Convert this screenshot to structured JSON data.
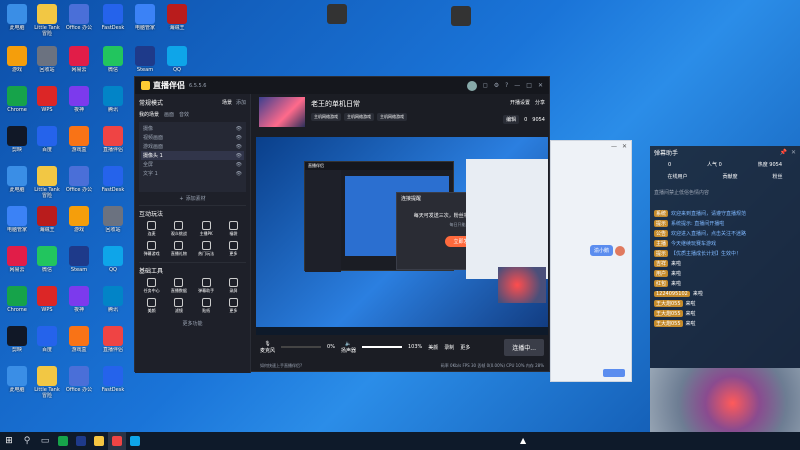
{
  "desktop_icons": [
    {
      "label": "此电脑",
      "color": "#3a8ee6"
    },
    {
      "label": "Little Tank 冒险",
      "color": "#f2c744"
    },
    {
      "label": "Office 办公",
      "color": "#4a6fd8"
    },
    {
      "label": "FastDesk",
      "color": "#2563eb"
    },
    {
      "label": "电脑管家",
      "color": "#3b82f6"
    },
    {
      "label": "海贼王",
      "color": "#b91c1c"
    },
    {
      "label": "游戏",
      "color": "#f59e0b"
    },
    {
      "label": "回收站",
      "color": "#6b7280"
    },
    {
      "label": "网易云",
      "color": "#e11d48"
    },
    {
      "label": "微信",
      "color": "#22c55e"
    },
    {
      "label": "Steam",
      "color": "#1e3a8a"
    },
    {
      "label": "QQ",
      "color": "#0ea5e9"
    },
    {
      "label": "Chrome",
      "color": "#16a34a"
    },
    {
      "label": "WPS",
      "color": "#dc2626"
    },
    {
      "label": "夜神",
      "color": "#7c3aed"
    },
    {
      "label": "腾讯",
      "color": "#0284c7"
    },
    {
      "label": "剪映",
      "color": "#111827"
    },
    {
      "label": "百度",
      "color": "#2563eb"
    },
    {
      "label": "游戏盒",
      "color": "#f97316"
    },
    {
      "label": "直播伴侣",
      "color": "#ef4444"
    }
  ],
  "app": {
    "title": "直播伴侣",
    "version": "6.5.5.6",
    "live_title": "老王的单机日常",
    "tags": [
      "主机网络游戏",
      "主机网络游戏",
      "主机网络游戏"
    ],
    "broadcast_btn": "开播设置",
    "share_btn": "分享",
    "likes": "0",
    "viewers": "9054",
    "scene_header": "常规模式",
    "scene_tab": "场景",
    "scene_add": "添加",
    "source_tabs": [
      "我的场景",
      "画面",
      "音效"
    ],
    "sources": [
      "摄像",
      "视频画面",
      "游戏画面",
      "摄像头 1",
      "全屏",
      "文字 1"
    ],
    "add_source": "添加素材",
    "section_interact": "互动玩法",
    "interact_items": [
      "连麦",
      "观众挑战",
      "主播PK",
      "福袋",
      "弹幕游戏",
      "直播礼物",
      "热门玩法",
      "更多"
    ],
    "section_tools": "基础工具",
    "tool_items": [
      "任务中心",
      "直播数据",
      "弹幕助手",
      "录屏",
      "美颜",
      "滤镜",
      "贴纸",
      "更多"
    ],
    "more": "更多功能",
    "mic_label": "麦克风",
    "mic_value": "0%",
    "speaker_label": "扬声器",
    "speaker_value": "103%",
    "btn_beauty": "美颜",
    "btn_record": "录制",
    "btn_more": "更多",
    "btn_go_live": "连播中...",
    "status_text": "如何快速上手直播伴侣?",
    "stats": "码率 0Kb/s   FPS 30   丢帧 0(0.00%)   CPU 10%   内存 28%"
  },
  "dialog": {
    "title": "连接提醒",
    "line1": "每天可发送三次，粉丝将在斗鱼APP收到提醒",
    "line2": "每日只能发两条",
    "btn": "立即发送"
  },
  "inner_app": {
    "title": "直播伴侣"
  },
  "chat_window": {
    "user": "渝小鹅"
  },
  "right_panel": {
    "title": "弹幕助手",
    "tabs": [
      "在线用户",
      "贡献度",
      "粉丝"
    ],
    "counts": [
      "0",
      "人气 0",
      "热度 9054"
    ],
    "pinned": "直播间禁止低俗色情内容",
    "messages": [
      {
        "name": "系统",
        "text": "欢迎来到直播间，请遵守直播规范"
      },
      {
        "name": "提示",
        "text": "系统提示: 直播间开播啦"
      },
      {
        "name": "公告",
        "text": "欢迎进入直播间，点击关注不迷路"
      },
      {
        "name": "主播",
        "text": "今天继续玩赛车游戏"
      },
      {
        "name": "提示",
        "text": "【优质主播成长计划】生效中！"
      },
      {
        "name": "吉祥",
        "text": "来啦"
      },
      {
        "name": "用户",
        "text": "来啦"
      },
      {
        "name": "红包",
        "text": "来啦"
      },
      {
        "name": "1224095102",
        "text": "来啦"
      },
      {
        "name": "王大炮055",
        "text": "来啦"
      },
      {
        "name": "王大炮055",
        "text": "来啦"
      },
      {
        "name": "王大炮055",
        "text": "来啦"
      }
    ]
  },
  "taskbar": {
    "time": "",
    "apps": [
      "start",
      "search",
      "task-view",
      "chrome",
      "steam",
      "file-explorer",
      "douyin",
      "qq"
    ]
  }
}
